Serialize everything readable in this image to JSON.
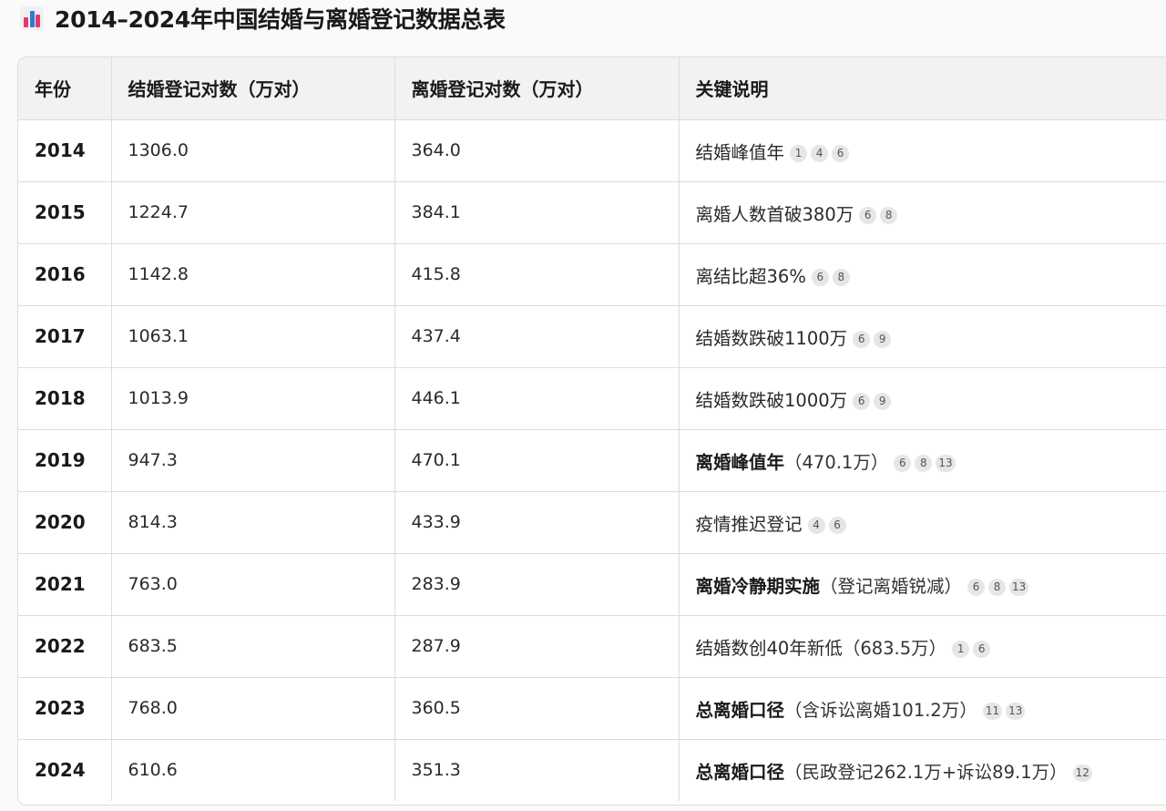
{
  "page": {
    "title": "2014–2024年中国结婚与离婚登记数据总表",
    "title_icon": "bar-chart-icon"
  },
  "table": {
    "headers": [
      "年份",
      "结婚登记对数（万对）",
      "离婚登记对数（万对）",
      "关键说明"
    ],
    "rows": [
      {
        "year": "2014",
        "marriage": "1306.0",
        "divorce": "364.0",
        "note_bold": "",
        "note": "结婚峰值年",
        "note_paren": "",
        "cites": [
          "1",
          "4",
          "6"
        ]
      },
      {
        "year": "2015",
        "marriage": "1224.7",
        "divorce": "384.1",
        "note_bold": "",
        "note": "离婚人数首破380万",
        "note_paren": "",
        "cites": [
          "6",
          "8"
        ]
      },
      {
        "year": "2016",
        "marriage": "1142.8",
        "divorce": "415.8",
        "note_bold": "",
        "note": "离结比超36%",
        "note_paren": "",
        "cites": [
          "6",
          "8"
        ]
      },
      {
        "year": "2017",
        "marriage": "1063.1",
        "divorce": "437.4",
        "note_bold": "",
        "note": "结婚数跌破1100万",
        "note_paren": "",
        "cites": [
          "6",
          "9"
        ]
      },
      {
        "year": "2018",
        "marriage": "1013.9",
        "divorce": "446.1",
        "note_bold": "",
        "note": "结婚数跌破1000万",
        "note_paren": "",
        "cites": [
          "6",
          "9"
        ]
      },
      {
        "year": "2019",
        "marriage": "947.3",
        "divorce": "470.1",
        "note_bold": "离婚峰值年",
        "note": "",
        "note_paren": "（470.1万）",
        "cites": [
          "6",
          "8",
          "13"
        ]
      },
      {
        "year": "2020",
        "marriage": "814.3",
        "divorce": "433.9",
        "note_bold": "",
        "note": "疫情推迟登记",
        "note_paren": "",
        "cites": [
          "4",
          "6"
        ]
      },
      {
        "year": "2021",
        "marriage": "763.0",
        "divorce": "283.9",
        "note_bold": "离婚冷静期实施",
        "note": "",
        "note_paren": "（登记离婚锐减）",
        "cites": [
          "6",
          "8",
          "13"
        ]
      },
      {
        "year": "2022",
        "marriage": "683.5",
        "divorce": "287.9",
        "note_bold": "",
        "note": "结婚数创40年新低",
        "note_paren": "（683.5万）",
        "cites": [
          "1",
          "6"
        ]
      },
      {
        "year": "2023",
        "marriage": "768.0",
        "divorce": "360.5",
        "note_bold": "总离婚口径",
        "note": "",
        "note_paren": "（含诉讼离婚101.2万）",
        "cites": [
          "11",
          "13"
        ]
      },
      {
        "year": "2024",
        "marriage": "610.6",
        "divorce": "351.3",
        "note_bold": "总离婚口径",
        "note": "",
        "note_paren": "（民政登记262.1万+诉讼89.1万）",
        "cites": [
          "12"
        ]
      }
    ]
  }
}
